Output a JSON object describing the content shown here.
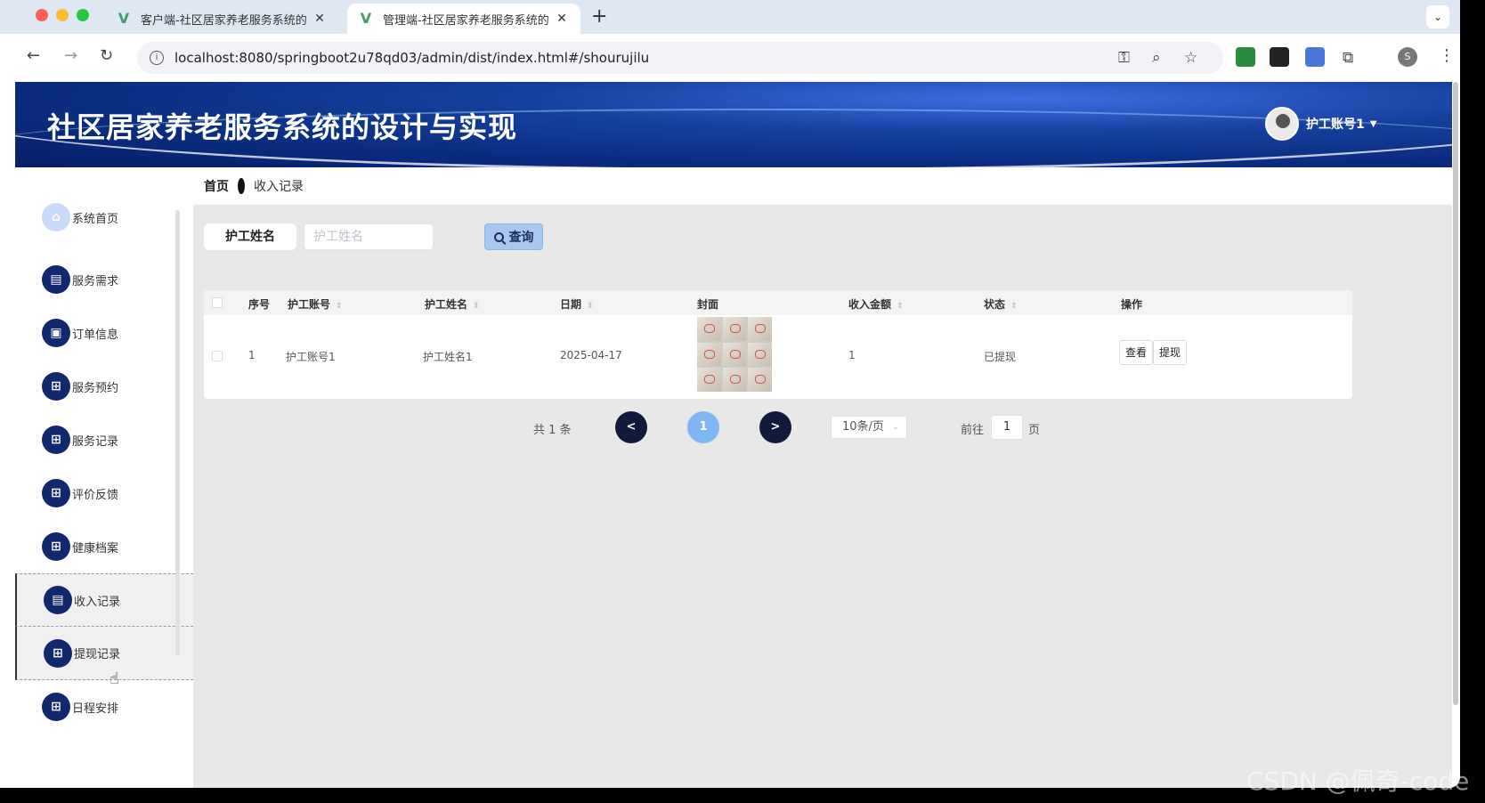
{
  "browser": {
    "tabs": [
      {
        "title": "客户端-社区居家养老服务系统的",
        "active": false
      },
      {
        "title": "管理端-社区居家养老服务系统的",
        "active": true
      }
    ],
    "new_tab": "+",
    "url": "localhost:8080/springboot2u78qd03/admin/dist/index.html#/shourujilu",
    "profile_initial": "S"
  },
  "app": {
    "title": "社区居家养老服务系统的设计与实现",
    "user": "护工账号1"
  },
  "sidebar": {
    "items": [
      {
        "label": "系统首页",
        "icon": "home-icon"
      },
      {
        "label": "服务需求",
        "icon": "clipboard-icon"
      },
      {
        "label": "订单信息",
        "icon": "briefcase-icon"
      },
      {
        "label": "服务预约",
        "icon": "grid-icon"
      },
      {
        "label": "服务记录",
        "icon": "grid-icon"
      },
      {
        "label": "评价反馈",
        "icon": "grid-icon"
      },
      {
        "label": "健康档案",
        "icon": "grid-icon"
      },
      {
        "label": "收入记录",
        "icon": "clipboard-icon"
      },
      {
        "label": "提现记录",
        "icon": "grid-icon"
      },
      {
        "label": "日程安排",
        "icon": "grid-icon"
      }
    ]
  },
  "breadcrumb": {
    "home": "首页",
    "current": "收入记录"
  },
  "search": {
    "label": "护工姓名",
    "placeholder": "护工姓名",
    "button": "查询"
  },
  "table": {
    "headers": [
      "序号",
      "护工账号",
      "护工姓名",
      "日期",
      "封面",
      "收入金额",
      "状态",
      "操作"
    ],
    "rows": [
      {
        "index": "1",
        "account": "护工账号1",
        "name": "护工姓名1",
        "date": "2025-04-17",
        "amount": "1",
        "status": "已提现",
        "view": "查看",
        "withdraw": "提现"
      }
    ]
  },
  "pagination": {
    "total": "共 1 条",
    "prev": "<",
    "current": "1",
    "next": ">",
    "page_size": "10条/页",
    "goto_label": "前往",
    "goto_value": "1",
    "page_unit": "页"
  },
  "watermark": "CSDN @佩奇-code"
}
